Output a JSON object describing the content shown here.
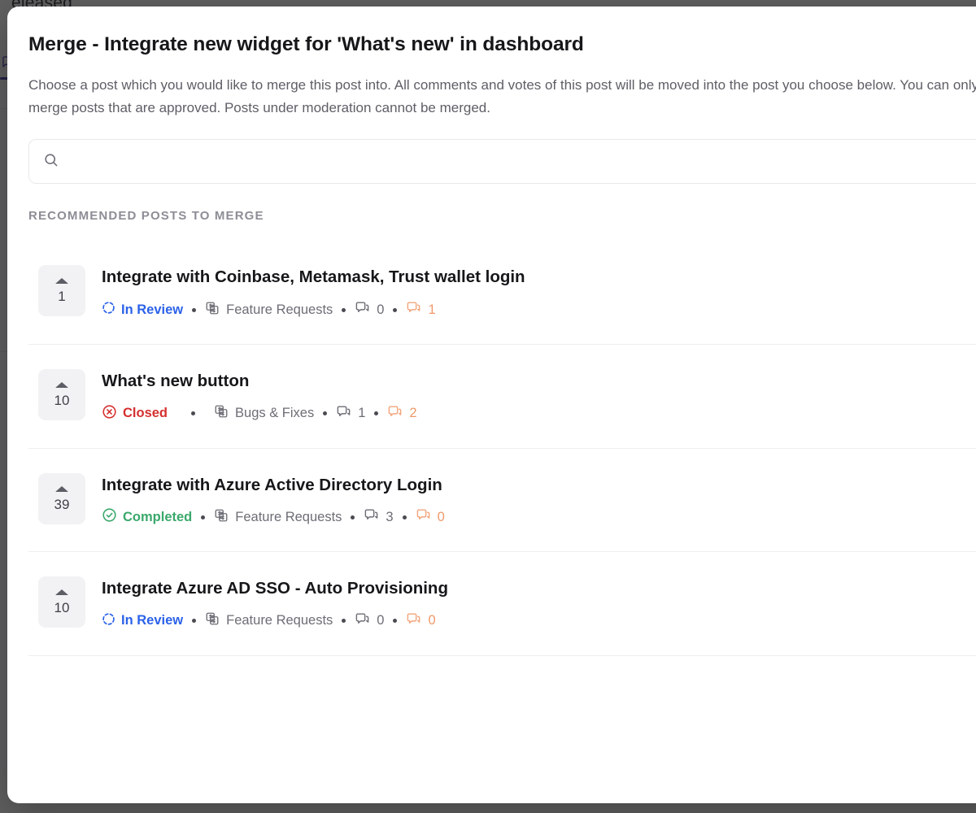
{
  "background": {
    "partial_word": "eleased",
    "tab_icon": "comment-icon"
  },
  "dialog": {
    "title": "Merge - Integrate new widget for 'What's new' in dashboard",
    "description": "Choose a post which you would like to merge this post into. All comments and votes of this post will be moved into the post you choose below. You can only merge posts that are approved. Posts under moderation cannot be merged.",
    "search": {
      "icon": "search-icon",
      "value": "",
      "placeholder": ""
    },
    "section_label": "Recommended posts to merge",
    "colors": {
      "status_in_review": "#2b62e8",
      "status_closed": "#d63030",
      "status_completed": "#3aa86b",
      "accent_orange": "#f0996a",
      "text_muted": "#6d6d76",
      "overlay": "#1c1c1e"
    },
    "posts": [
      {
        "votes": "1",
        "title": "Integrate with Coinbase, Metamask, Trust wallet login",
        "status": "In Review",
        "status_kind": "in-review",
        "status_icon": "loader-circle-icon",
        "category_icon": "replace-icon",
        "category": "Feature Requests",
        "comments_icon": "comments-icon",
        "comments": "0",
        "notes_icon": "comments-accent-icon",
        "notes": "1"
      },
      {
        "votes": "10",
        "title": "What's new button",
        "status": "Closed",
        "status_kind": "closed",
        "status_icon": "x-circle-icon",
        "category_icon": "replace-icon",
        "category": "Bugs & Fixes",
        "comments_icon": "comments-icon",
        "comments": "1",
        "notes_icon": "comments-accent-icon",
        "notes": "2"
      },
      {
        "votes": "39",
        "title": "Integrate with Azure Active Directory Login",
        "status": "Completed",
        "status_kind": "completed",
        "status_icon": "check-circle-icon",
        "category_icon": "replace-icon",
        "category": "Feature Requests",
        "comments_icon": "comments-icon",
        "comments": "3",
        "notes_icon": "comments-accent-icon",
        "notes": "0"
      },
      {
        "votes": "10",
        "title": "Integrate Azure AD SSO - Auto Provisioning",
        "status": "In Review",
        "status_kind": "in-review",
        "status_icon": "loader-circle-icon",
        "category_icon": "replace-icon",
        "category": "Feature Requests",
        "comments_icon": "comments-icon",
        "comments": "0",
        "notes_icon": "comments-accent-icon",
        "notes": "0"
      }
    ]
  }
}
